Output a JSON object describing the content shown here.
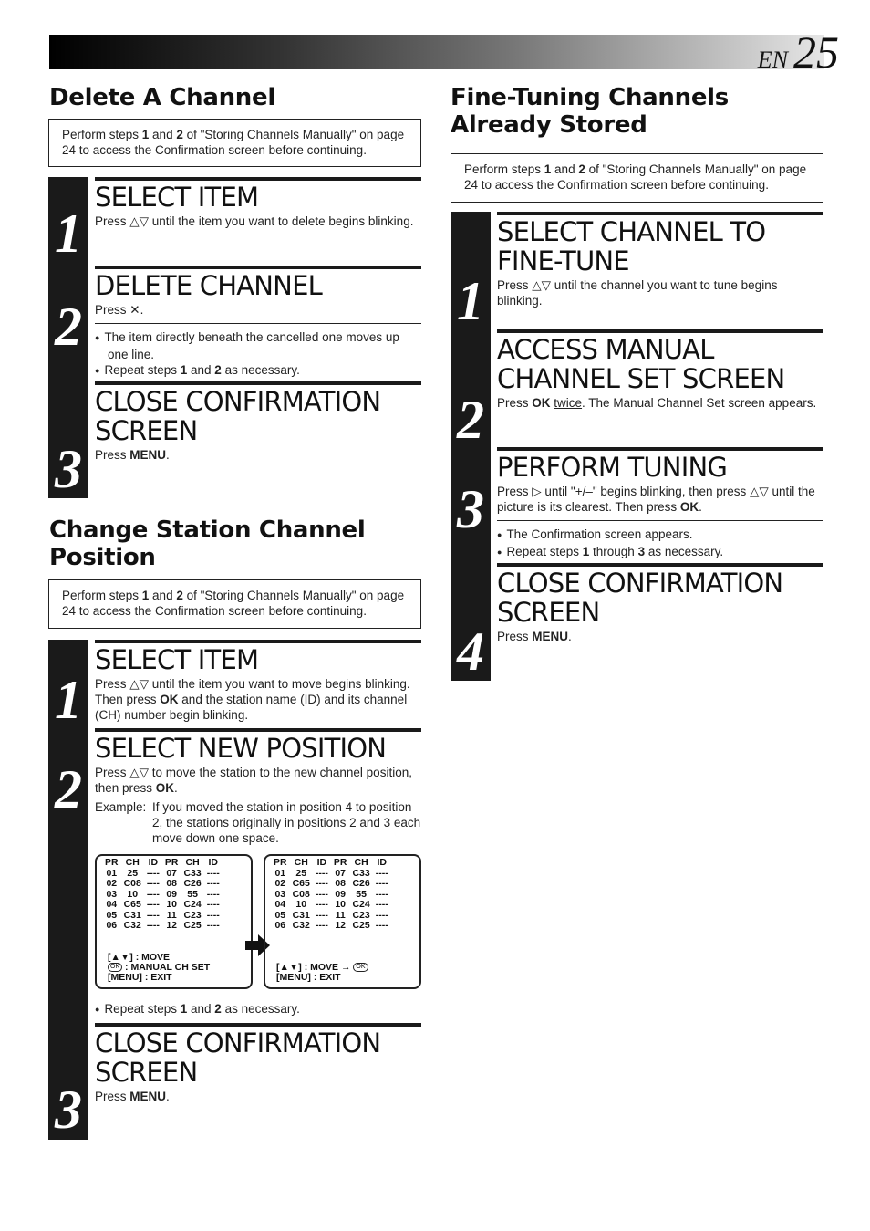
{
  "header": {
    "lang": "EN",
    "page_number": "25"
  },
  "delete_channel": {
    "title": "Delete A Channel",
    "note": {
      "a": "Perform steps ",
      "b1": "1",
      "c": " and ",
      "b2": "2",
      "d": " of \"Storing Channels Manually\" on page 24 to access the Confirmation screen before continuing."
    },
    "steps": [
      {
        "num": "1",
        "heading": "SELECT ITEM",
        "text": "Press △▽ until the item you want to delete begins blinking."
      },
      {
        "num": "2",
        "heading": "DELETE CHANNEL",
        "text_pre": "Press ",
        "text_key": "✕",
        "text_post": ".",
        "bullets": [
          "The item directly beneath the cancelled one moves up one line."
        ],
        "repeat": {
          "a": "Repeat steps ",
          "b1": "1",
          "c": " and ",
          "b2": "2",
          "d": " as necessary."
        }
      },
      {
        "num": "3",
        "heading_l1": "CLOSE CONFIRMATION",
        "heading_l2": "SCREEN",
        "text_pre": "Press ",
        "text_key": "MENU",
        "text_post": "."
      }
    ]
  },
  "change_position": {
    "title_l1": "Change Station Channel",
    "title_l2": "Position",
    "note": {
      "a": "Perform steps ",
      "b1": "1",
      "c": " and ",
      "b2": "2",
      "d": " of \"Storing Channels Manually\" on page 24 to access the Confirmation screen before continuing."
    },
    "steps": [
      {
        "num": "1",
        "heading": "SELECT ITEM",
        "t1": "Press △▽ until the item you want to move begins blinking. Then press ",
        "k1": "OK",
        "t2": " and the station name (ID) and its channel (CH) number begin blinking."
      },
      {
        "num": "2",
        "heading": "SELECT NEW POSITION",
        "t1": "Press △▽ to move the station to the new channel position, then press ",
        "k1": "OK",
        "t2": ".",
        "example_label": "Example:",
        "example_text": "If you moved the station in position 4 to position 2, the stations originally in positions 2 and 3 each move down one space.",
        "repeat": {
          "a": "Repeat steps ",
          "b1": "1",
          "c": " and ",
          "b2": "2",
          "d": " as necessary."
        }
      },
      {
        "num": "3",
        "heading_l1": "CLOSE CONFIRMATION",
        "heading_l2": "SCREEN",
        "text_pre": "Press ",
        "text_key": "MENU",
        "text_post": "."
      }
    ],
    "osd_before": {
      "headers": [
        "PR",
        "CH",
        "ID",
        "PR",
        "CH",
        "ID"
      ],
      "rows": [
        [
          "01",
          "25",
          "----",
          "07",
          "C33",
          "----"
        ],
        [
          "02",
          "C08",
          "----",
          "08",
          "C26",
          "----"
        ],
        [
          "03",
          "10",
          "----",
          "09",
          "55",
          "----"
        ],
        [
          "04",
          "C65",
          "----",
          "10",
          "C24",
          "----"
        ],
        [
          "05",
          "C31",
          "----",
          "11",
          "C23",
          "----"
        ],
        [
          "06",
          "C32",
          "----",
          "12",
          "C25",
          "----"
        ]
      ],
      "legend": [
        "[▲▼] : MOVE",
        ": MANUAL CH SET",
        "[MENU] : EXIT"
      ],
      "ok_icon": "OK"
    },
    "osd_after": {
      "headers": [
        "PR",
        "CH",
        "ID",
        "PR",
        "CH",
        "ID"
      ],
      "rows": [
        [
          "01",
          "25",
          "----",
          "07",
          "C33",
          "----"
        ],
        [
          "02",
          "C65",
          "----",
          "08",
          "C26",
          "----"
        ],
        [
          "03",
          "C08",
          "----",
          "09",
          "55",
          "----"
        ],
        [
          "04",
          "10",
          "----",
          "10",
          "C24",
          "----"
        ],
        [
          "05",
          "C31",
          "----",
          "11",
          "C23",
          "----"
        ],
        [
          "06",
          "C32",
          "----",
          "12",
          "C25",
          "----"
        ]
      ],
      "legend": [
        "[▲▼] : MOVE →",
        "[MENU] : EXIT"
      ],
      "ok_icon": "OK"
    }
  },
  "fine_tuning": {
    "title_l1": "Fine-Tuning Channels",
    "title_l2": "Already Stored",
    "note": {
      "a": "Perform steps ",
      "b1": "1",
      "c": " and ",
      "b2": "2",
      "d": " of \"Storing Channels Manually\" on page 24 to access the Confirmation screen before continuing."
    },
    "steps": [
      {
        "num": "1",
        "heading_l1": "SELECT CHANNEL TO",
        "heading_l2": "FINE-TUNE",
        "text": "Press △▽ until the channel you want to tune begins blinking."
      },
      {
        "num": "2",
        "heading_l1": "ACCESS MANUAL",
        "heading_l2": "CHANNEL SET SCREEN",
        "t1": "Press ",
        "k1": "OK",
        "t2": " ",
        "u1": "twice",
        "t3": ". The Manual Channel Set screen appears."
      },
      {
        "num": "3",
        "heading": "PERFORM TUNING",
        "t1": "Press ▷ until \"+/–\" begins blinking, then press △▽ until the picture is its clearest. Then press ",
        "k1": "OK",
        "t2": ".",
        "bullets": [
          "The Confirmation screen appears."
        ],
        "repeat": {
          "a": "Repeat steps ",
          "b1": "1",
          "c": " through ",
          "b2": "3",
          "d": " as necessary."
        }
      },
      {
        "num": "4",
        "heading_l1": "CLOSE CONFIRMATION",
        "heading_l2": "SCREEN",
        "text_pre": "Press ",
        "text_key": "MENU",
        "text_post": "."
      }
    ]
  }
}
